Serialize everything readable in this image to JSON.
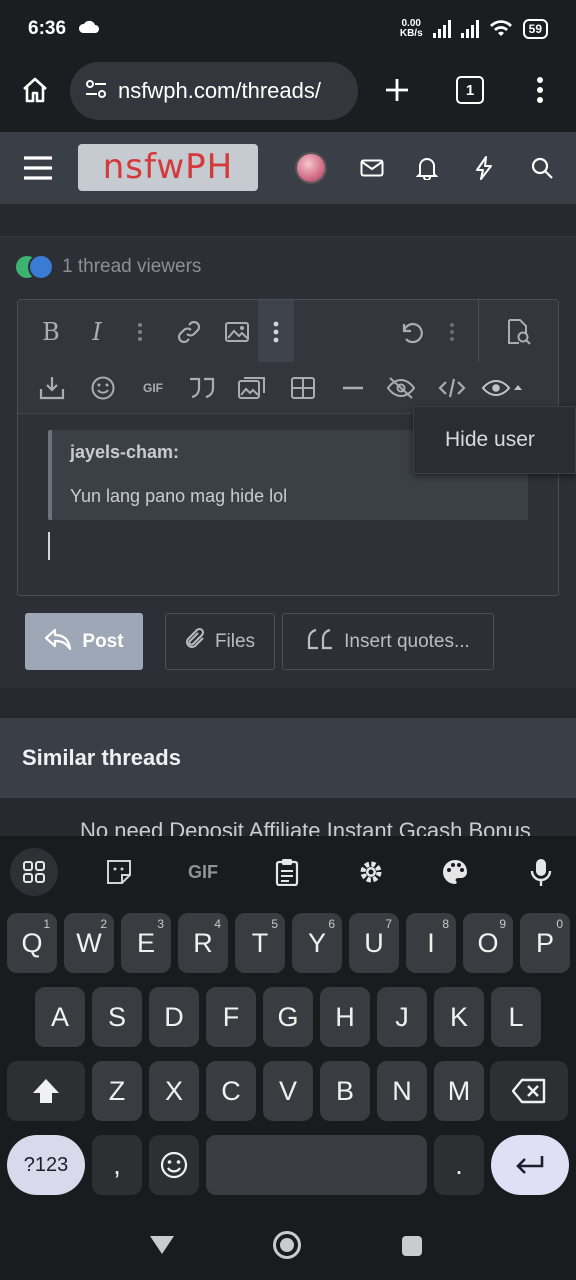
{
  "status_bar": {
    "time": "6:36",
    "net_speed": "0.00",
    "net_unit": "KB/s",
    "battery": "59"
  },
  "browser": {
    "url": "nsfwph.com/threads/",
    "tab_count": "1"
  },
  "site": {
    "logo_text": "nsfwPH"
  },
  "thread": {
    "viewers_text": "1 thread viewers"
  },
  "editor": {
    "toolbar_row1": [
      "B",
      "I"
    ],
    "gif_label": "GIF",
    "quote_author": "jayels-cham:",
    "quote_text": "Yun lang pano mag hide lol"
  },
  "popup": {
    "hide_user": "Hide user"
  },
  "actions": {
    "post": "Post",
    "files": "Files",
    "insert_quotes": "Insert quotes..."
  },
  "similar": {
    "title": "Similar threads",
    "peek_item": "No need Deposit Affiliate Instant Gcash Bonus"
  },
  "keyboard": {
    "gif_label": "GIF",
    "row1": [
      {
        "k": "Q",
        "h": "1"
      },
      {
        "k": "W",
        "h": "2"
      },
      {
        "k": "E",
        "h": "3"
      },
      {
        "k": "R",
        "h": "4"
      },
      {
        "k": "T",
        "h": "5"
      },
      {
        "k": "Y",
        "h": "6"
      },
      {
        "k": "U",
        "h": "7"
      },
      {
        "k": "I",
        "h": "8"
      },
      {
        "k": "O",
        "h": "9"
      },
      {
        "k": "P",
        "h": "0"
      }
    ],
    "row2": [
      "A",
      "S",
      "D",
      "F",
      "G",
      "H",
      "J",
      "K",
      "L"
    ],
    "row3": [
      "Z",
      "X",
      "C",
      "V",
      "B",
      "N",
      "M"
    ],
    "sym_label": "?123",
    "comma": ",",
    "period": "."
  },
  "colors": {
    "accent_post": "#9ea7b5",
    "logo_text": "#d33a3a",
    "header_bg": "#3a3f47"
  }
}
